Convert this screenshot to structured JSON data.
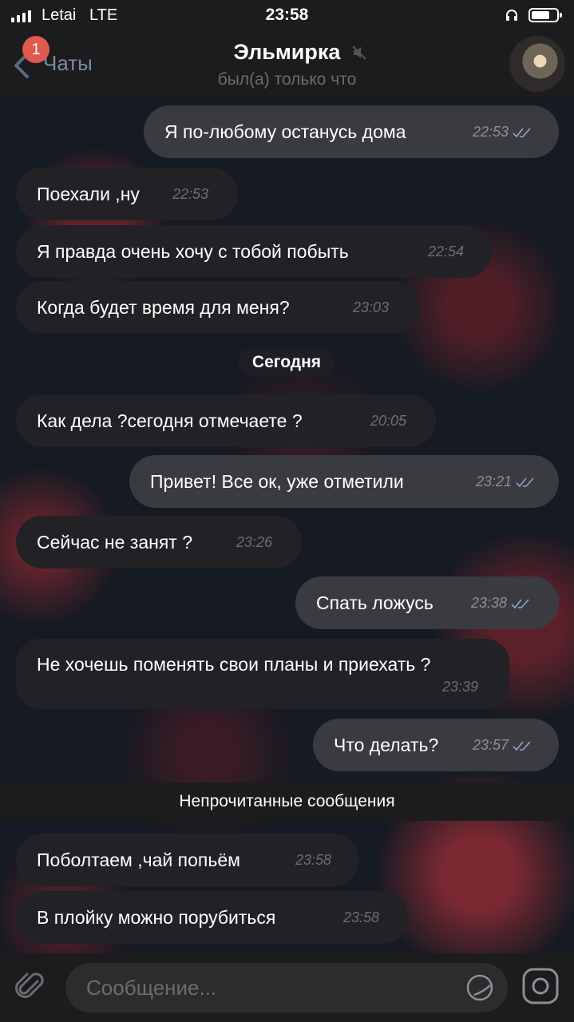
{
  "status_bar": {
    "carrier": "Letai",
    "network": "LTE",
    "time": "23:58"
  },
  "header": {
    "back_label": "Чаты",
    "unread_badge": "1",
    "title": "Эльмирка",
    "subtitle": "был(а) только что"
  },
  "messages": [
    {
      "dir": "out",
      "text": "Я по-любому останусь дома",
      "time": "22:53"
    },
    {
      "dir": "in",
      "text": "Поехали ,ну",
      "time": "22:53"
    },
    {
      "dir": "in",
      "text": "Я правда очень хочу с тобой побыть",
      "time": "22:54"
    },
    {
      "dir": "in",
      "text": "Когда будет время для меня?",
      "time": "23:03"
    },
    {
      "dir": "in",
      "text": "Как дела ?сегодня отмечаете ?",
      "time": "20:05"
    },
    {
      "dir": "out",
      "text": "Привет! Все ок, уже отметили",
      "time": "23:21"
    },
    {
      "dir": "in",
      "text": "Сейчас не занят ?",
      "time": "23:26"
    },
    {
      "dir": "out",
      "text": "Спать ложусь",
      "time": "23:38"
    },
    {
      "dir": "in",
      "text": "Не хочешь поменять свои планы и приехать ?",
      "time": "23:39"
    },
    {
      "dir": "out",
      "text": "Что делать?",
      "time": "23:57"
    },
    {
      "dir": "in",
      "text": "Поболтаем ,чай попьём",
      "time": "23:58"
    },
    {
      "dir": "in",
      "text": "В плойку можно порубиться",
      "time": "23:58"
    }
  ],
  "day_separator": "Сегодня",
  "unread_separator": "Непрочитанные сообщения",
  "composer": {
    "placeholder": "Сообщение..."
  },
  "colors": {
    "incoming_bubble": "#222226",
    "outgoing_bubble": "#3a3b40",
    "badge": "#e0584e",
    "read_check": "#8fa6c8"
  }
}
